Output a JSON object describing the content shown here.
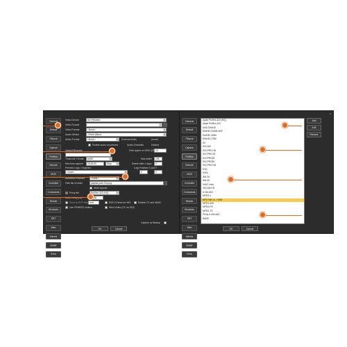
{
  "close_glyph": "×",
  "left_window": {
    "sidebar": [
      "General",
      "Default",
      "Playout",
      "Capture",
      "ProRes",
      "Remote",
      "MOS",
      "Controller",
      "Commands",
      "Mosaic",
      "Shortcuts",
      "SRT",
      "Web",
      "Alarms",
      "SNMP",
      "Extra"
    ],
    "active_item": "ProRes",
    "video_device_label": "Video Device",
    "video_device_value": "NDI Receive",
    "video_source_label": "Video Source",
    "video_format_label": "Video Format",
    "video_format_value": "<None>",
    "audio_device_label": "Audio Device",
    "audio_device_value": "<From Video>",
    "audio_format_label": "Audio Format",
    "audio_format_value": "<None>",
    "external_audio_label": "External Audio",
    "external_audio_value": "(none)",
    "enable_audio_preview_label": "Enable audio on preview",
    "audio_channels_label": "Audio Channels",
    "audio_channels_value": "Default",
    "default_filename_label": "Default filename",
    "free_space_label": "Free space on HDD (GB)",
    "free_space_value": "10",
    "timecode_format_label": "Timecode Format",
    "timecode_format_value": "tc430",
    "max_buffer_label": "Max buffer",
    "max_buffer_value": "236",
    "max_time_capture_label": "Max time capture",
    "max_time_capture_value": "00:00:00",
    "stop_value": "Stop",
    "delete_after_label": "Delete after n days",
    "delete_after_value": "0",
    "preview_logo_label": "Preview Logo / Graphics",
    "logo_position_label": "Logo Position X and Y",
    "preview_logo_value": "<none>",
    "logo_x": "0",
    "logo_y": "0",
    "additional_encoder_label": "Additional encoder",
    "additional_encoder_value": "<none>",
    "path_file_label": "Path file & folder",
    "path_file_value": "playlist-path-%d.png",
    "write_layouts_label": "Write layouts",
    "proxy_file_label": "Proxy file",
    "proxy_file_value": "ProRes 422 (HQ)",
    "audio_delay_label": "Audio delay(ms)",
    "audio_delay_value": "0.000",
    "send_to_label": "Send to RCP folder",
    "send_to_value": "/rcm",
    "raf_lines_label": "RAF-10 lines for IMX",
    "enable_cc_label": "Enable CC and VANC",
    "use_ffmpeg_label": "Use FFMPEG codecs",
    "strict_video_label": "Strict Video (CC on SDI)",
    "capture_at_startup_label": "Capture at Startup",
    "ok_label": "OK",
    "cancel_label": "Cancel"
  },
  "right_window": {
    "sidebar": [
      "General",
      "Default",
      "Playout",
      "Capture",
      "ProRes",
      "Remote",
      "MOS",
      "Controller",
      "Commands",
      "Mosaic",
      "Shortcuts",
      "SRT",
      "Web",
      "Alarms",
      "SNMP",
      "Extra"
    ],
    "active_item": "ProRes",
    "codec_list": [
      "Apple ProRes 422 (HQ)",
      "Apple ProRes 422",
      "AVID DNxHD",
      "DNxHD 120Mb MXF",
      "DNxHD 145M",
      "DNxHD 175M",
      "DV",
      "DVCAM",
      "DVCPRO HD",
      "DVCPRO 50",
      "DVCPRO25",
      "DVCPRO50",
      "DVCPRO HD",
      "DVD",
      "H264",
      "IMX 30",
      "IMX 50",
      "XAVC Intra",
      "XDCAM HD",
      "H.264 AVC",
      "MPEG-2",
      "MP4 Part 14 - H264",
      "MPEG-IMX",
      "MPEG-PS",
      "MPEG-TS",
      "Proxy H.264 AAC",
      "WAVE"
    ],
    "selected_index": 21,
    "add_label": "Add",
    "edit_label": "Edit",
    "remove_label": "Remove",
    "ok_label": "OK",
    "cancel_label": "Cancel"
  },
  "colors": {
    "accent": "#e8691c",
    "selection": "#f5cc4e",
    "window_bg": "#2c2c2c"
  }
}
